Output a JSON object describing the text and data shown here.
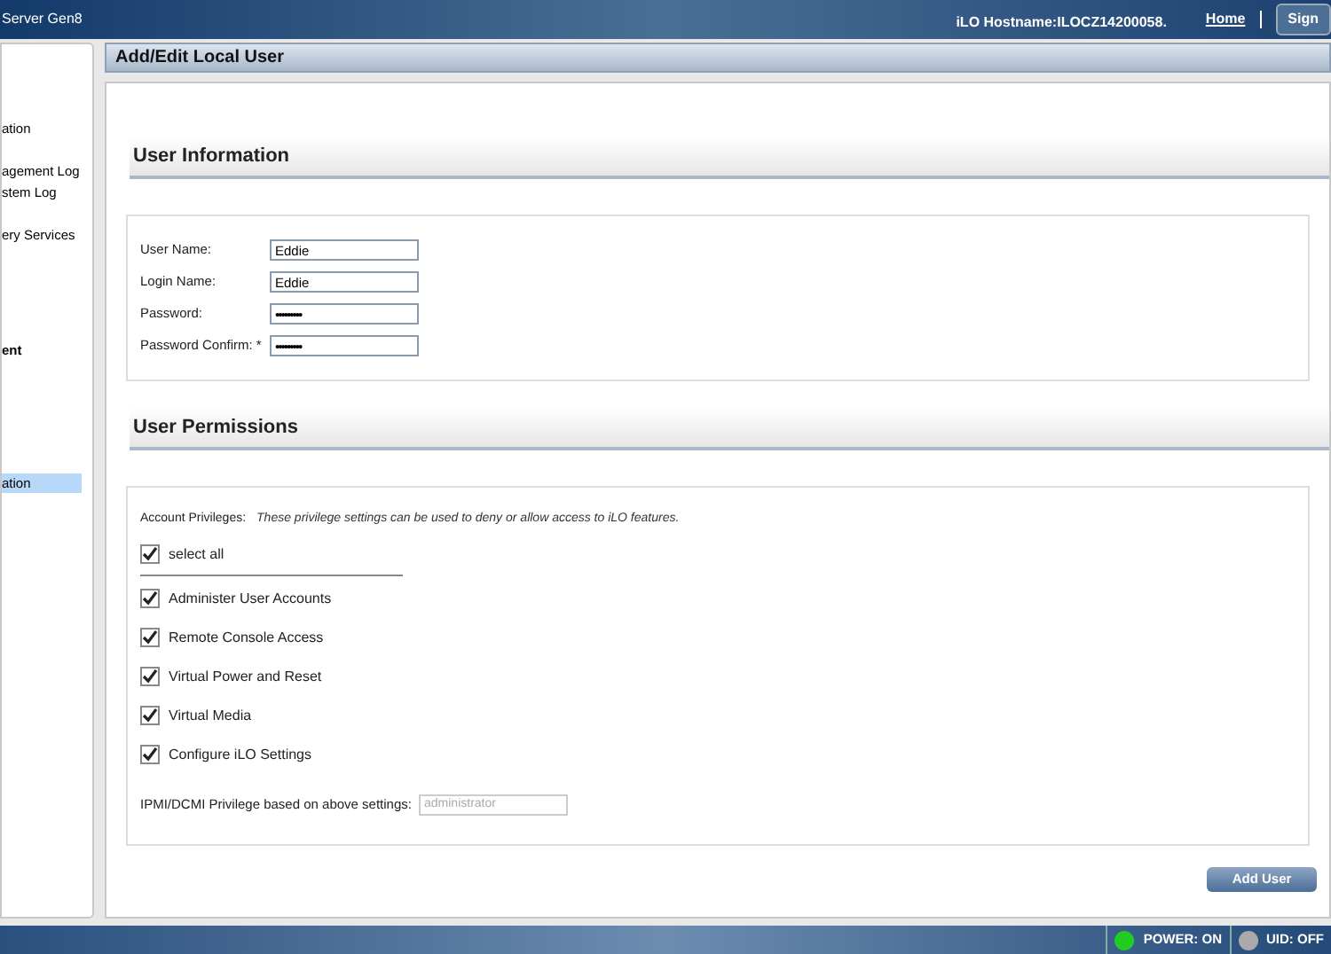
{
  "header": {
    "product": "Server Gen8",
    "hostname": "iLO Hostname:ILOCZ14200058.",
    "links": [
      {
        "label": "Home"
      }
    ],
    "sign_button": "Sign"
  },
  "sidebar": {
    "items": [
      {
        "label": "ation",
        "selected": false
      },
      {
        "label": "agement Log",
        "selected": false
      },
      {
        "label": "stem Log",
        "selected": false
      },
      {
        "label": "ery Services",
        "selected": false
      },
      {
        "label": "ent",
        "selected": false
      },
      {
        "label": "ation",
        "selected": true
      }
    ]
  },
  "page_title": "Add/Edit Local User",
  "user_information": {
    "heading": "User Information",
    "fields": [
      {
        "label": "User Name:",
        "value": "Eddie",
        "kind": "text"
      },
      {
        "label": "Login Name:",
        "value": "Eddie",
        "kind": "text"
      },
      {
        "label": "Password:",
        "value": "•••••••••",
        "kind": "password"
      },
      {
        "label": "Password Confirm: *",
        "value": "•••••••••",
        "kind": "password"
      }
    ]
  },
  "user_permissions": {
    "heading": "User Permissions",
    "privileges_label": "Account Privileges:",
    "privileges_note": "These privilege settings can be used to deny or allow access to iLO features.",
    "select_all": {
      "label": "select all",
      "checked": true
    },
    "privileges": [
      {
        "label": "Administer User Accounts",
        "checked": true
      },
      {
        "label": "Remote Console Access",
        "checked": true
      },
      {
        "label": "Virtual Power and Reset",
        "checked": true
      },
      {
        "label": "Virtual Media",
        "checked": true
      },
      {
        "label": "Configure iLO Settings",
        "checked": true
      }
    ],
    "ipmi_label": "IPMI/DCMI Privilege based on above settings:",
    "ipmi_value": "administrator"
  },
  "add_button": "Add User",
  "status_bar": {
    "indicators": [
      {
        "label": "POWER: ON",
        "color": "#22cc22"
      },
      {
        "label": "UID: OFF",
        "color": "#aaaaaa"
      }
    ]
  }
}
